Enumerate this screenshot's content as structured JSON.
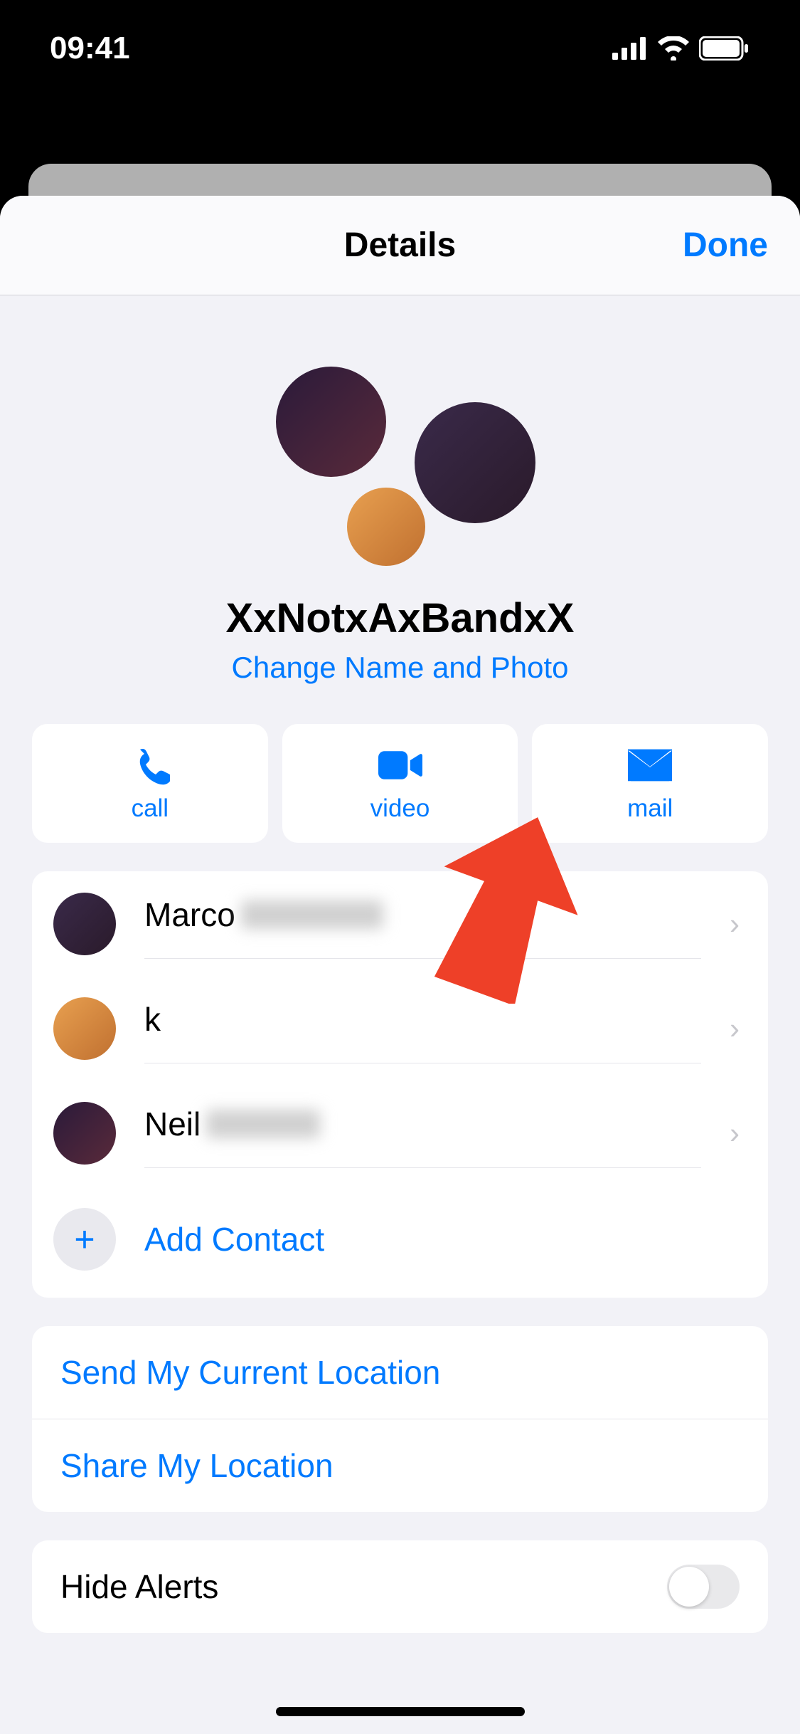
{
  "statusBar": {
    "time": "09:41"
  },
  "nav": {
    "title": "Details",
    "done": "Done"
  },
  "group": {
    "name": "XxNotxAxBandxX",
    "changeLink": "Change Name and Photo"
  },
  "actions": {
    "call": "call",
    "video": "video",
    "mail": "mail"
  },
  "members": [
    {
      "name": "Marco",
      "redacted": true
    },
    {
      "name": "k",
      "redacted": false
    },
    {
      "name": "Neil",
      "redacted": true
    }
  ],
  "addContact": "Add Contact",
  "location": {
    "send": "Send My Current Location",
    "share": "Share My Location"
  },
  "alerts": {
    "label": "Hide Alerts"
  }
}
